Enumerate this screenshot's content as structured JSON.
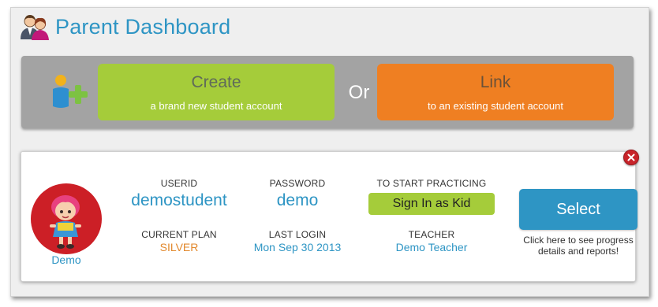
{
  "header": {
    "title": "Parent Dashboard",
    "icon": "parents-icon"
  },
  "actions": {
    "add_icon": "add-student-icon",
    "create": {
      "title": "Create",
      "subtitle": "a brand new student account"
    },
    "or_label": "Or",
    "link": {
      "title": "Link",
      "subtitle": "to an existing student account"
    }
  },
  "student": {
    "avatar_name": "Demo",
    "userid_label": "USERID",
    "userid": "demostudent",
    "password_label": "PASSWORD",
    "password": "demo",
    "practice_label": "TO START PRACTICING",
    "practice_button": "Sign In as Kid",
    "plan_label": "CURRENT PLAN",
    "plan": "SILVER",
    "last_login_label": "LAST LOGIN",
    "last_login": "Mon Sep 30 2013",
    "teacher_label": "TEACHER",
    "teacher": "Demo Teacher",
    "select_button": "Select",
    "select_hint_line1": "Click here to see progress",
    "select_hint_line2": "details and reports!"
  },
  "colors": {
    "accent_blue": "#2e95c4",
    "green": "#a5cc3a",
    "orange": "#ef7f22",
    "close_red": "#c8242a",
    "plan_orange": "#e2892e"
  }
}
